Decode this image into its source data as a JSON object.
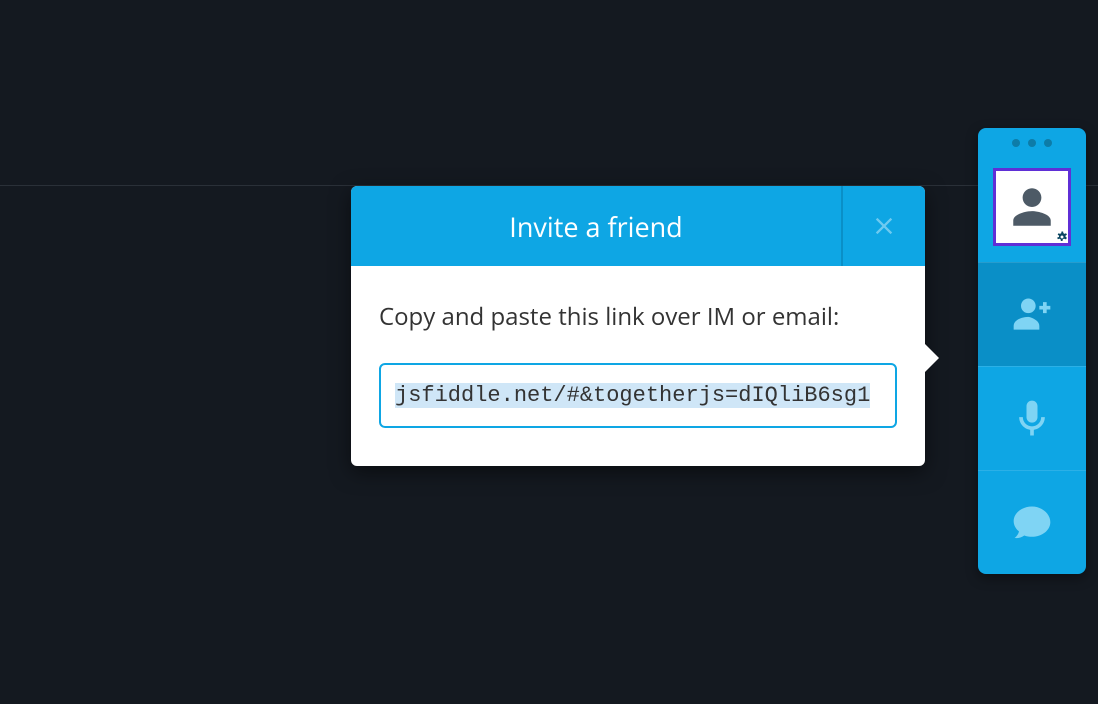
{
  "modal": {
    "title": "Invite a friend",
    "instructions": "Copy and paste this link over IM or email:",
    "link_value": "jsfiddle.net/#&togetherjs=dIQliB6sg1"
  },
  "sidebar": {
    "avatar_icon": "person-icon",
    "items": [
      {
        "id": "add-friend",
        "icon": "person-plus-icon",
        "active": true
      },
      {
        "id": "mic",
        "icon": "microphone-icon",
        "active": false
      },
      {
        "id": "chat",
        "icon": "chat-icon",
        "active": false
      }
    ]
  }
}
